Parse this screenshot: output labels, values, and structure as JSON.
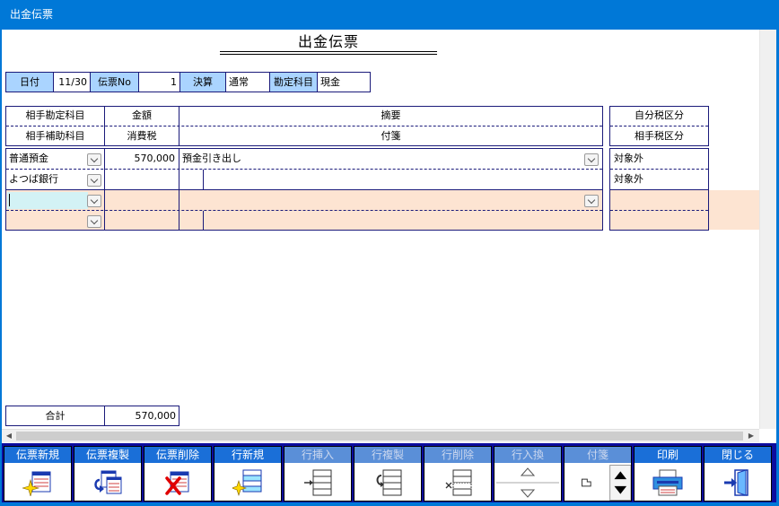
{
  "window": {
    "title": "出金伝票"
  },
  "page": {
    "title": "出金伝票"
  },
  "info": {
    "date_label": "日付",
    "date_value": "11/30",
    "slipno_label": "伝票No",
    "slipno_value": "1",
    "settle_label": "決算",
    "settle_value": "通常",
    "account_label": "勘定科目",
    "account_value": "現金"
  },
  "headers": {
    "partner_account": "相手勘定科目",
    "partner_sub": "相手補助科目",
    "amount": "金額",
    "tax": "消費税",
    "summary": "摘要",
    "tag": "付箋",
    "own_tax": "自分税区分",
    "partner_tax": "相手税区分"
  },
  "rows": [
    {
      "account": "普通預金",
      "sub": "よつば銀行",
      "amount": "570,000",
      "tax": "",
      "summary": "預金引き出し",
      "tag": "",
      "own_tax": "対象外",
      "partner_tax": "対象外"
    },
    {
      "account": "",
      "sub": "",
      "amount": "",
      "tax": "",
      "summary": "",
      "tag": "",
      "own_tax": "",
      "partner_tax": ""
    }
  ],
  "total": {
    "label": "合計",
    "value": "570,000"
  },
  "toolbar": [
    {
      "label": "伝票新規",
      "icon": "new-slip-icon",
      "enabled": true
    },
    {
      "label": "伝票複製",
      "icon": "copy-slip-icon",
      "enabled": true
    },
    {
      "label": "伝票削除",
      "icon": "delete-slip-icon",
      "enabled": true
    },
    {
      "label": "行新規",
      "icon": "new-row-icon",
      "enabled": true
    },
    {
      "label": "行挿入",
      "icon": "insert-row-icon",
      "enabled": false
    },
    {
      "label": "行複製",
      "icon": "copy-row-icon",
      "enabled": false
    },
    {
      "label": "行削除",
      "icon": "delete-row-icon",
      "enabled": false
    },
    {
      "label": "行入換",
      "icon": "swap-rows-icon",
      "enabled": false
    },
    {
      "label": "付箋",
      "icon": "tag-icon",
      "enabled": false
    },
    {
      "label": "印刷",
      "icon": "printer-icon",
      "enabled": true
    },
    {
      "label": "閉じる",
      "icon": "exit-door-icon",
      "enabled": true
    }
  ],
  "colors": {
    "titlebar": "#0078d7",
    "label_bg": "#aad4ff",
    "active_row": "#fde4d2",
    "toolbar_bg": "#0c0c9e",
    "button_label": "#1a6fd8"
  }
}
